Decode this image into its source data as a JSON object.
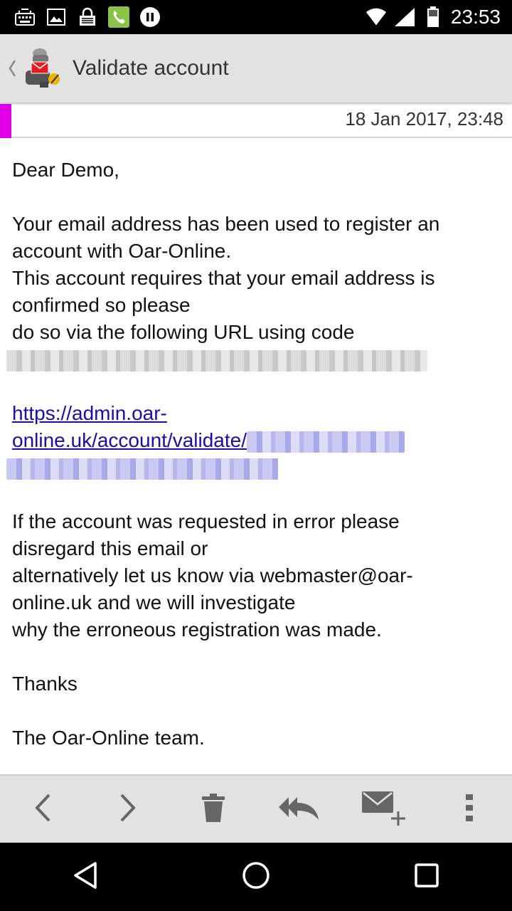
{
  "status_bar": {
    "time": "23:53",
    "icons": [
      "keyboard-icon",
      "image-icon",
      "vpn-lock-icon",
      "phone-icon",
      "pause-icon",
      "wifi-icon",
      "signal-icon",
      "battery-icon"
    ]
  },
  "action_bar": {
    "title": "Validate account"
  },
  "email": {
    "date": "18 Jan 2017, 23:48",
    "accent_color": "#e000e8",
    "lines": {
      "greeting": "Dear Demo,",
      "p1_l1": "Your email address has been used to register an",
      "p1_l2": "account with Oar-Online.",
      "p1_l3": "This account requires that your email address is",
      "p1_l4": "confirmed so please",
      "p1_l5": "do so via the following URL using code",
      "link_l1": "https://admin.oar-",
      "link_l2": "online.uk/account/validate/",
      "p3_l1": "If the account was requested in error please",
      "p3_l2": "disregard this email or",
      "p3_l3": "alternatively let us know via webmaster@oar-",
      "p3_l4": "online.uk and we will investigate",
      "p3_l5": "why the erroneous registration was made.",
      "thanks": "Thanks",
      "signature": "The Oar-Online team."
    }
  },
  "toolbar": {
    "buttons": [
      "previous-icon",
      "next-icon",
      "delete-icon",
      "reply-all-icon",
      "compose-icon",
      "overflow-menu-icon"
    ]
  },
  "nav_bar": {
    "buttons": [
      "back-icon",
      "home-icon",
      "recents-icon"
    ]
  }
}
